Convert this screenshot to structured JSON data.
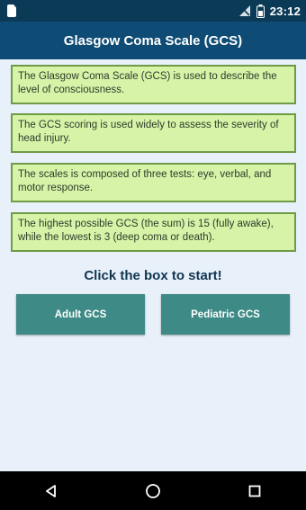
{
  "status_bar": {
    "time": "23:12",
    "icons": [
      "sd-card-icon",
      "signal-off-icon",
      "battery-icon"
    ]
  },
  "app_bar": {
    "title": "Glasgow Coma Scale (GCS)"
  },
  "info_boxes": [
    {
      "text": "The Glasgow Coma Scale (GCS) is used to describe the level of consciousness."
    },
    {
      "text": "The GCS scoring is used widely to assess the severity of head injury."
    },
    {
      "text": "The scales is composed of three tests: eye, verbal, and motor response."
    },
    {
      "text": "The highest possible GCS (the sum) is 15 (fully awake), while the lowest is 3 (deep coma or death)."
    }
  ],
  "cta_text": "Click the box to start!",
  "buttons": {
    "adult": "Adult GCS",
    "pediatric": "Pediatric GCS"
  },
  "nav": {
    "back": "back-icon",
    "home": "home-icon",
    "recents": "recents-icon"
  },
  "colors": {
    "status_bar": "#0b3a57",
    "app_bar": "#0f4c75",
    "background": "#e8f0fa",
    "info_box_fill": "#d6f3a8",
    "info_box_border": "#6f9a46",
    "button": "#3d8a86"
  }
}
